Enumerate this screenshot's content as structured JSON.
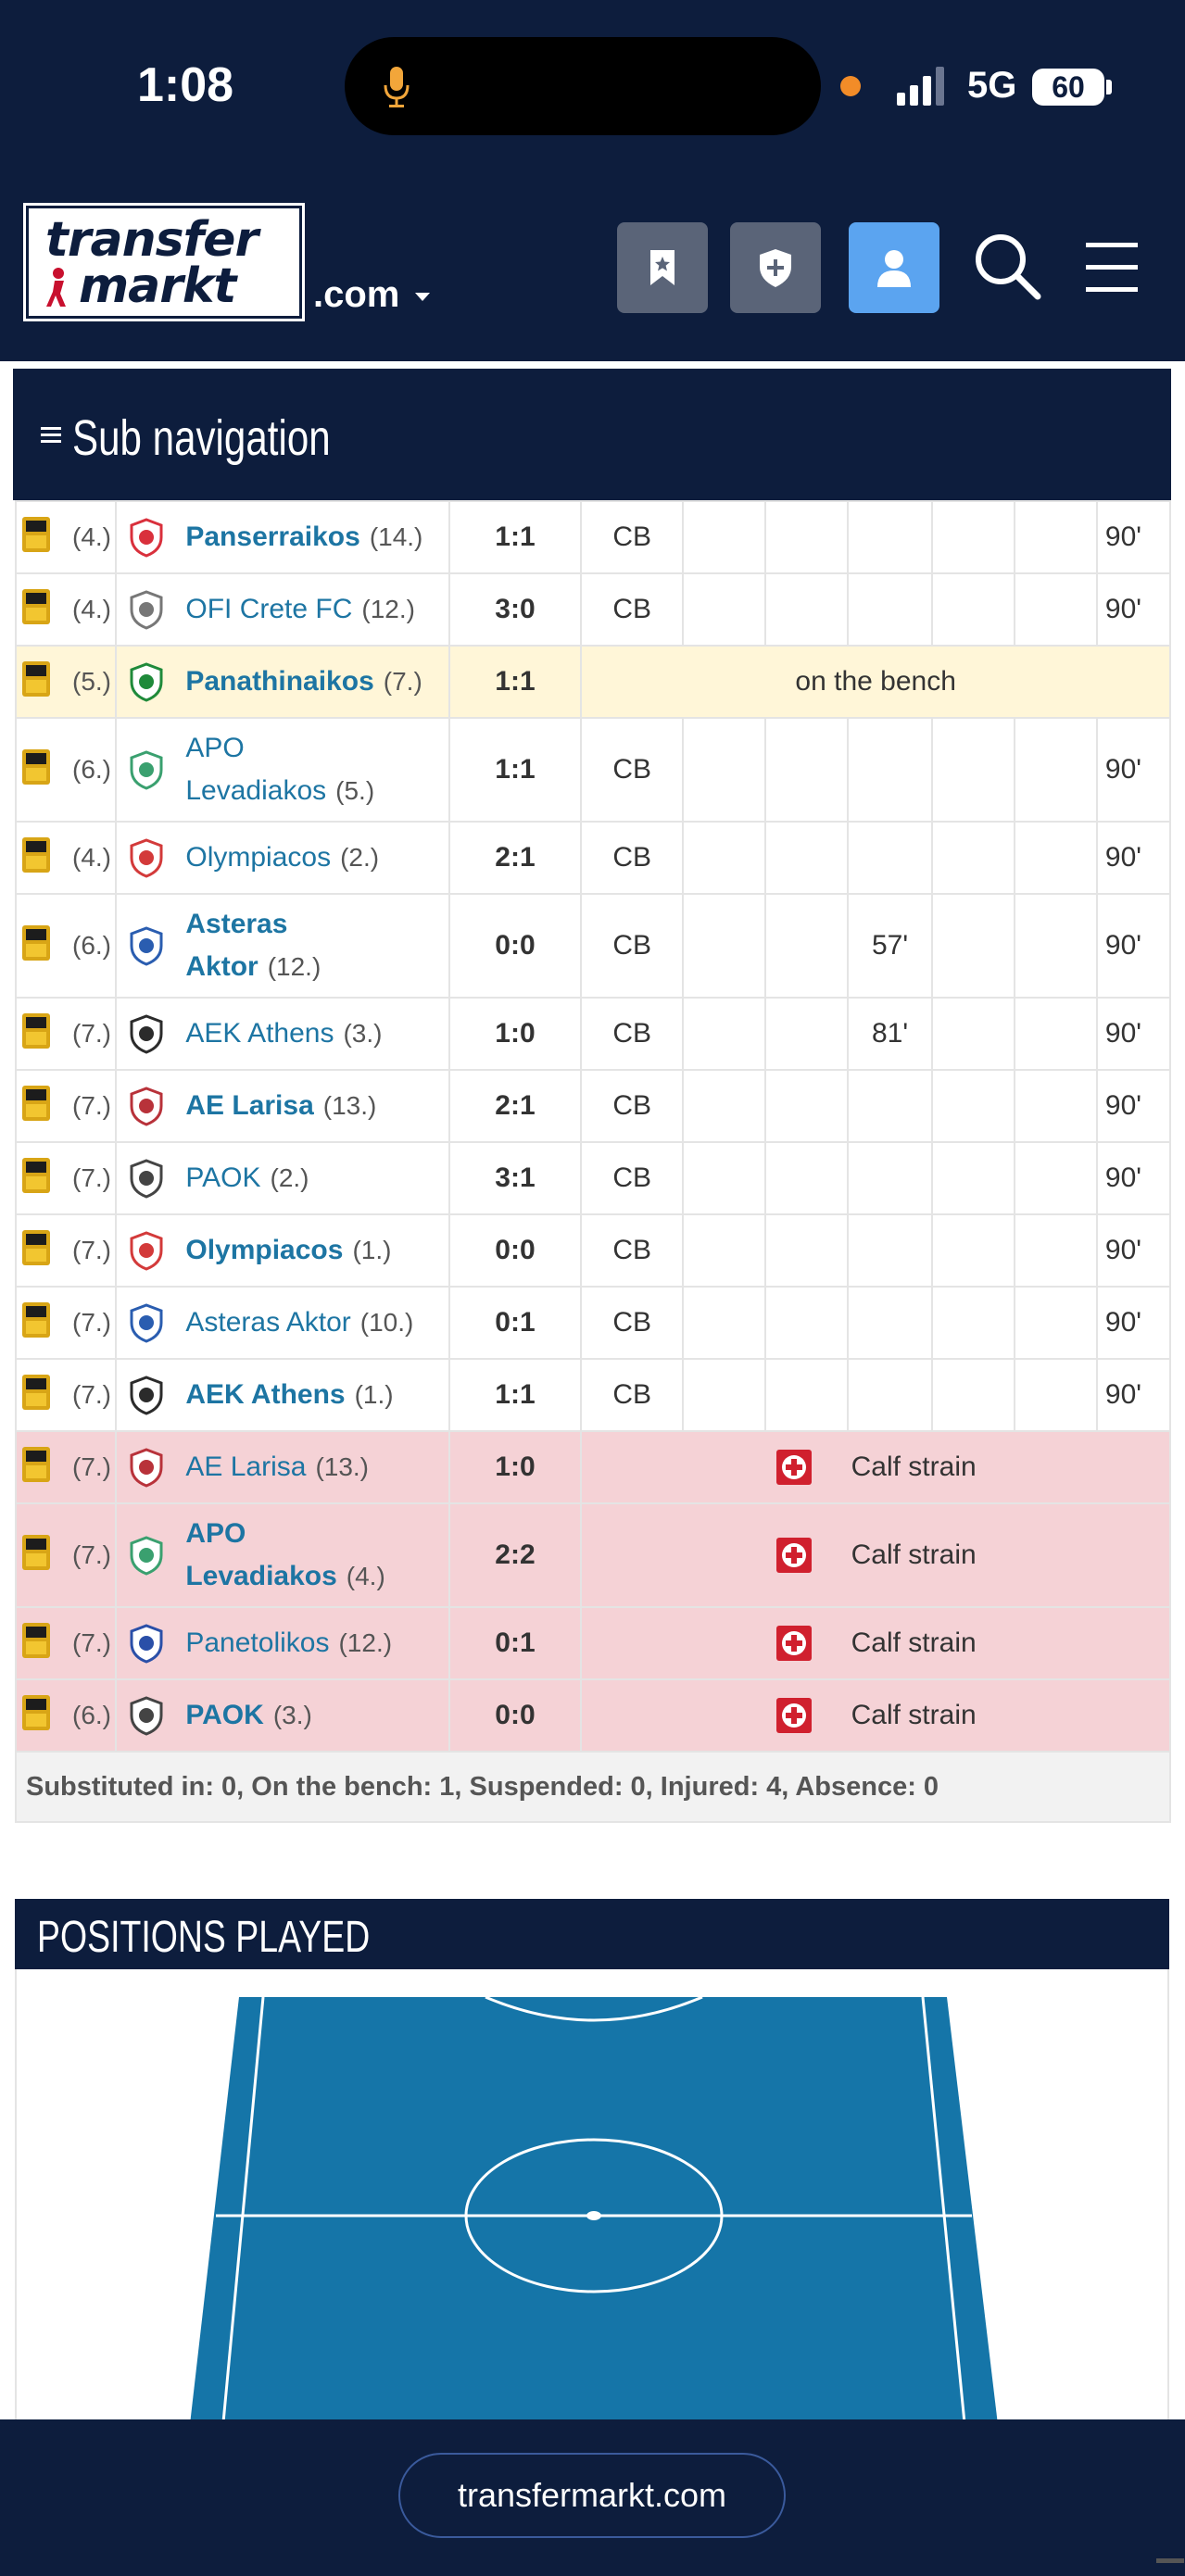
{
  "status_bar": {
    "time": "1:08",
    "network": "5G",
    "battery": "60"
  },
  "header": {
    "logo_line1": "transfer",
    "logo_line2": "markt",
    "domain_suffix": ".com",
    "buttons": [
      "bookmark-icon",
      "shield-plus-icon",
      "user-icon",
      "search-icon",
      "menu-icon"
    ]
  },
  "subnav": {
    "label": "Sub navigation"
  },
  "matches": [
    {
      "rank": "(4.)",
      "opponent": "Panserraikos",
      "opp_rank": "(14.)",
      "bold": true,
      "result": "1:1",
      "result_type": "draw",
      "pos": "CB",
      "e1": "",
      "e2": "",
      "e3": "",
      "e4": "",
      "e5": "",
      "minutes": "90'"
    },
    {
      "rank": "(4.)",
      "opponent": "OFI Crete FC",
      "opp_rank": "(12.)",
      "bold": false,
      "result": "3:0",
      "result_type": "loss",
      "pos": "CB",
      "e1": "",
      "e2": "",
      "e3": "",
      "e4": "",
      "e5": "",
      "minutes": "90'"
    },
    {
      "rank": "(5.)",
      "opponent": "Panathinaikos",
      "opp_rank": "(7.)",
      "bold": true,
      "result": "1:1",
      "result_type": "draw",
      "status": "on the bench",
      "kind": "bench"
    },
    {
      "rank": "(6.)",
      "opponent_l1": "APO",
      "opponent": "Levadiakos",
      "opp_rank": "(5.)",
      "bold": false,
      "result": "1:1",
      "result_type": "draw",
      "pos": "CB",
      "e1": "",
      "e2": "",
      "e3": "",
      "e4": "",
      "e5": "",
      "minutes": "90'"
    },
    {
      "rank": "(4.)",
      "opponent": "Olympiacos",
      "opp_rank": "(2.)",
      "bold": false,
      "result": "2:1",
      "result_type": "loss",
      "pos": "CB",
      "e1": "",
      "e2": "",
      "e3": "",
      "e4": "",
      "e5": "",
      "minutes": "90'"
    },
    {
      "rank": "(6.)",
      "opponent_l1": "Asteras",
      "opponent": "Aktor",
      "opp_rank": "(12.)",
      "bold": true,
      "result": "0:0",
      "result_type": "draw",
      "pos": "CB",
      "e1": "",
      "e2": "",
      "e3": "57'",
      "e4": "",
      "e5": "",
      "minutes": "90'"
    },
    {
      "rank": "(7.)",
      "opponent": "AEK Athens",
      "opp_rank": "(3.)",
      "bold": false,
      "result": "1:0",
      "result_type": "loss",
      "pos": "CB",
      "e1": "",
      "e2": "",
      "e3": "81'",
      "e4": "",
      "e5": "",
      "minutes": "90'"
    },
    {
      "rank": "(7.)",
      "opponent": "AE Larisa",
      "opp_rank": "(13.)",
      "bold": true,
      "result": "2:1",
      "result_type": "win",
      "pos": "CB",
      "e1": "",
      "e2": "",
      "e3": "",
      "e4": "",
      "e5": "",
      "minutes": "90'"
    },
    {
      "rank": "(7.)",
      "opponent": "PAOK",
      "opp_rank": "(2.)",
      "bold": false,
      "result": "3:1",
      "result_type": "loss",
      "pos": "CB",
      "e1": "",
      "e2": "",
      "e3": "",
      "e4": "",
      "e5": "",
      "minutes": "90'"
    },
    {
      "rank": "(7.)",
      "opponent": "Olympiacos",
      "opp_rank": "(1.)",
      "bold": true,
      "result": "0:0",
      "result_type": "draw",
      "pos": "CB",
      "e1": "",
      "e2": "",
      "e3": "",
      "e4": "",
      "e5": "",
      "minutes": "90'"
    },
    {
      "rank": "(7.)",
      "opponent": "Asteras Aktor",
      "opp_rank": "(10.)",
      "bold": false,
      "result": "0:1",
      "result_type": "win",
      "pos": "CB",
      "e1": "",
      "e2": "",
      "e3": "",
      "e4": "",
      "e5": "",
      "minutes": "90'"
    },
    {
      "rank": "(7.)",
      "opponent": "AEK Athens",
      "opp_rank": "(1.)",
      "bold": true,
      "result": "1:1",
      "result_type": "draw",
      "pos": "CB",
      "e1": "",
      "e2": "",
      "e3": "",
      "e4": "",
      "e5": "",
      "minutes": "90'"
    },
    {
      "rank": "(7.)",
      "opponent": "AE Larisa",
      "opp_rank": "(13.)",
      "bold": false,
      "result": "1:0",
      "result_type": "loss",
      "status": "Calf strain",
      "kind": "injured"
    },
    {
      "rank": "(7.)",
      "opponent_l1": "APO",
      "opponent": "Levadiakos",
      "opp_rank": "(4.)",
      "bold": true,
      "result": "2:2",
      "result_type": "draw",
      "status": "Calf strain",
      "kind": "injured"
    },
    {
      "rank": "(7.)",
      "opponent": "Panetolikos",
      "opp_rank": "(12.)",
      "bold": false,
      "result": "0:1",
      "result_type": "win",
      "status": "Calf strain",
      "kind": "injured"
    },
    {
      "rank": "(6.)",
      "opponent": "PAOK",
      "opp_rank": "(3.)",
      "bold": true,
      "result": "0:0",
      "result_type": "draw",
      "status": "Calf strain",
      "kind": "injured"
    }
  ],
  "summary": "Substituted in: 0, On the bench: 1, Suspended: 0, Injured: 4, Absence: 0",
  "positions": {
    "title": "POSITIONS PLAYED",
    "pitch_color": "#1575a8",
    "line_color": "#ffffff"
  },
  "bottom_bar": {
    "url": "transfermarkt.com"
  },
  "colors": {
    "navy": "#0d1d3d",
    "link": "#1d75a3",
    "loss": "#b81e2a",
    "win": "#58a516",
    "bench_bg": "#fff6d8",
    "injured_bg": "#f5d2d6"
  }
}
